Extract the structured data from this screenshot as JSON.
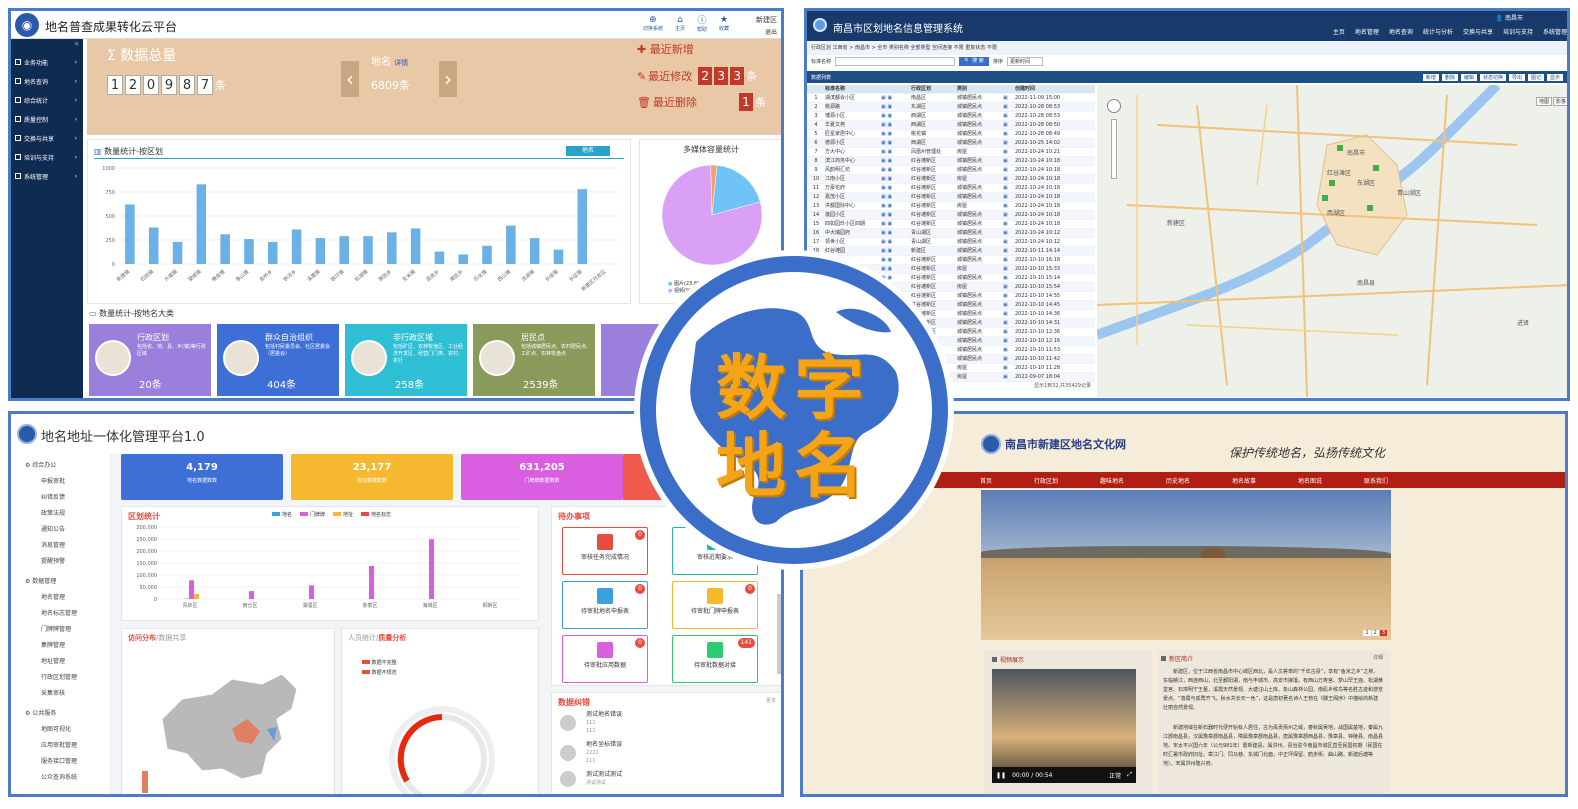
{
  "p1": {
    "title": "地名普查成果转化云平台",
    "header_icons": [
      "切换系统",
      "主页",
      "帮助",
      "收藏"
    ],
    "header_user": "新建区",
    "header_logout": "退出",
    "sidebar": [
      "业务功能",
      "地名查询",
      "综合统计",
      "质量控制",
      "交换与共享",
      "培训与支持",
      "系统管理"
    ],
    "total_label": "数据总量",
    "total_digits": [
      "1",
      "2",
      "0",
      "9",
      "8",
      "7"
    ],
    "total_unit": "条",
    "diming_label": "地名",
    "diming_link": "详情",
    "diming_count": "6809条",
    "recent_new": "最近新增",
    "recent_modified": "最近修改",
    "recent_modified_digits": [
      "2",
      "3",
      "3"
    ],
    "recent_deleted": "最近删除",
    "recent_deleted_digits": [
      "1"
    ],
    "recent_unit": "条",
    "bar_title": "数量统计-按区划",
    "bar_tab": "地名",
    "pie_title": "多媒体容量统计",
    "pie_legend": [
      "图片(23.86G)",
      "视频(97.99G)"
    ],
    "cat_title": "数量统计-按地名大类",
    "cats": [
      {
        "name": "行政区划",
        "desc": "包括省、地、县、乡(镇)等行政区域",
        "count": "20条"
      },
      {
        "name": "群众自治组织",
        "desc": "包括村民委员会、社区居委会（居委会）",
        "count": "404条"
      },
      {
        "name": "非行政区域",
        "desc": "包括矿区、农林牧渔区、工业经济开发区、经营门门类、农村、农行",
        "count": "258条"
      },
      {
        "name": "居民点",
        "desc": "包括城镇居民点、农村居民点、工矿点、农林牧渔点",
        "count": "2539条"
      }
    ]
  },
  "chart1": {
    "type": "bar",
    "ylim": [
      0,
      1000
    ],
    "yticks": [
      "1000",
      "750",
      "500",
      "250",
      "0"
    ],
    "categories": [
      "新建镇",
      "石岗镇",
      "大塘镇",
      "望城镇",
      "樵舍镇",
      "象山镇",
      "金桥乡",
      "铁河乡",
      "溪霞镇",
      "联圩镇",
      "松湖镇",
      "厚田乡",
      "生米镇",
      "昌邑乡",
      "南矶乡",
      "乐化镇",
      "西山镇",
      "流湖镇",
      "长堎镇",
      "长征镇",
      "新建区开发区"
    ],
    "values": [
      620,
      380,
      230,
      830,
      310,
      260,
      230,
      360,
      270,
      290,
      290,
      330,
      370,
      130,
      100,
      190,
      400,
      270,
      150,
      780,
      0
    ]
  },
  "chart2": {
    "type": "pie",
    "slices": [
      {
        "name": "图片",
        "value": 23.86,
        "color": "#6fc3f7"
      },
      {
        "name": "视频",
        "value": 97.99,
        "color": "#d9a0f5"
      },
      {
        "name": "其他",
        "value": 2.5,
        "color": "#f3a06a"
      }
    ]
  },
  "p2": {
    "title": "南昌市区划地名信息管理系统",
    "menu": [
      "主页",
      "地名管理",
      "地名查询",
      "统计与分析",
      "交换与共享",
      "培训与支持",
      "系统管理"
    ],
    "user": "南昌市",
    "filters": "行政区划 江西省 > 南昌市 > 全市   类别名称 全部类型   空间连接 不限   重复状态 不限",
    "search_label": "标准名称",
    "search_button": "搜 索",
    "sort_label": "排序",
    "sort_value": "更新时间",
    "list_title": "数据列表",
    "toolbar": [
      "新增",
      "删除",
      "编辑",
      "状态切换",
      "导出",
      "图记",
      "显示"
    ],
    "columns": [
      "标准名称",
      "行政区划",
      "类别",
      "创建时间"
    ],
    "rows": [
      [
        "湖滨都会小区",
        "南昌区",
        "城镇居民点",
        "2022-11-09 15:00"
      ],
      [
        "桃源路",
        "东湖区",
        "城镇居民点",
        "2022-10-28 08:53"
      ],
      [
        "博源小区",
        "西湖区",
        "城镇居民点",
        "2022-10-28 08:53"
      ],
      [
        "华夏文苑",
        "西湖区",
        "城镇居民点",
        "2022-10-28 08:50"
      ],
      [
        "匠星家居中心",
        "桃花镇",
        "城镇居民点",
        "2022-10-28 08:49"
      ],
      [
        "德源小区",
        "西湖区",
        "城镇居民点",
        "2022-10-25 14:02"
      ],
      [
        "方大中心",
        "凤凰州管理处",
        "房屋",
        "2022-10-24 10:21"
      ],
      [
        "滨江商务中心",
        "红谷滩新区",
        "城镇居民点",
        "2022-10-24 10:18"
      ],
      [
        "风韵明汇坊",
        "红谷滩新区",
        "城镇居民点",
        "2022-10-24 10:18"
      ],
      [
        "江南小区",
        "红谷滩新区",
        "房屋",
        "2022-10-24 10:18"
      ],
      [
        "万豪花府",
        "红谷滩新区",
        "城镇居民点",
        "2022-10-24 10:18"
      ],
      [
        "嘉茂小区",
        "红谷滩新区",
        "城镇居民点",
        "2022-10-24 10:18"
      ],
      [
        "洪都国际中心",
        "红谷滩新区",
        "房屋",
        "2022-10-24 10:18"
      ],
      [
        "莲园小区",
        "红谷滩新区",
        "城镇居民点",
        "2022-10-24 10:18"
      ],
      [
        "四如园珍小区四期",
        "红谷滩新区",
        "城镇居民点",
        "2022-10-24 10:18"
      ],
      [
        "中大瑞园府",
        "青山湖区",
        "城镇居民点",
        "2022-10-24 10:12"
      ],
      [
        "领世小区",
        "青山湖区",
        "城镇居民点",
        "2022-10-24 10:12"
      ],
      [
        "红谷滩园",
        "新建区",
        "城镇居民点",
        "2022-10-11 14:14"
      ],
      [
        "",
        "红谷滩新区",
        "城镇居民点",
        "2022-10-10 16:18"
      ],
      [
        "",
        "红谷滩新区",
        "房屋",
        "2022-10-10 15:33"
      ],
      [
        "",
        "红谷滩新区",
        "城镇居民点",
        "2022-10-10 15:14"
      ],
      [
        "",
        "红谷滩新区",
        "房屋",
        "2022-10-10 15:54"
      ],
      [
        "",
        "红谷滩新区",
        "城镇居民点",
        "2022-10-10 14:55"
      ],
      [
        "",
        "红谷滩新区",
        "城镇居民点",
        "2022-10-10 14:45"
      ],
      [
        "",
        "红谷滩新区",
        "城镇居民点",
        "2022-10-10 14:36"
      ],
      [
        "",
        "红谷滩新区",
        "城镇居民点",
        "2022-10-10 14:31"
      ],
      [
        "",
        "红谷滩新区",
        "城镇居民点",
        "2022-10-10 12:36"
      ],
      [
        "",
        "红谷滩新区",
        "城镇居民点",
        "2022-10-10 12:16"
      ],
      [
        "",
        "红谷滩新区",
        "城镇居民点",
        "2022-10-10 11:53"
      ],
      [
        "",
        "红谷滩新区",
        "城镇居民点",
        "2022-10-10 11:42"
      ],
      [
        "",
        "红谷滩新区",
        "房屋",
        "2022-10-10 11:28"
      ],
      [
        "",
        "红谷滩新区",
        "房屋",
        "2022-09-07 18:04"
      ]
    ],
    "footer": "显示1到32,共35429记录",
    "map_tabs": [
      "地图",
      "影像"
    ],
    "map_labels": [
      "南昌市",
      "新建区",
      "青山湖区",
      "东湖区",
      "西湖区",
      "红谷滩区",
      "南昌县",
      "进贤"
    ]
  },
  "p3": {
    "title": "地名地址一体化管理平台1.0",
    "nav": [
      {
        "group": "综合办公",
        "items": [
          "申报审批",
          "纠错反馈",
          "政策法规",
          "通知公告",
          "消息管理",
          "提醒预警"
        ]
      },
      {
        "group": "数据管理",
        "items": [
          "地名管理",
          "地名标志管理",
          "门牌牌管理",
          "集牌管理",
          "地址管理",
          "行政区划管理",
          "采集审核"
        ]
      },
      {
        "group": "公共服务",
        "items": [
          "地图可视化",
          "应用审批管理",
          "服务接口管理",
          "公众查询系统"
        ]
      }
    ],
    "stats": [
      {
        "value": "4,179",
        "label": "地名数据数数",
        "color": "#3d6fd6"
      },
      {
        "value": "23,177",
        "label": "地址数据数数",
        "color": "#f5b82e"
      },
      {
        "value": "631,205",
        "label": "门牌牌数据数数",
        "color": "#d95ee0"
      }
    ],
    "region_title": "区划统计",
    "legend": [
      "地名",
      "门牌牌",
      "地址",
      "地名标志"
    ],
    "region_yticks": [
      "300,000",
      "250,000",
      "200,000",
      "150,000",
      "100,000",
      "50,000",
      "0"
    ],
    "region_x": [
      "青妖区",
      "南仓区",
      "湖湄区",
      "象萦区",
      "海城区",
      "桐碗区"
    ],
    "todo_title": "待办事项",
    "todos": [
      {
        "label": "审核任务完成情况",
        "badge": "0",
        "color": "#e74c3c"
      },
      {
        "label": "审核近期要求",
        "badge": "",
        "color": "#2ab3a6"
      },
      {
        "label": "待审批地名申报表",
        "badge": "0",
        "color": "#3aa0e0"
      },
      {
        "label": "待审批门牌申报表",
        "badge": "0",
        "color": "#f5b82e"
      },
      {
        "label": "待审批应用数据",
        "badge": "0",
        "color": "#d95ee0"
      },
      {
        "label": "待审批数据对接",
        "badge": "141",
        "color": "#2ecc71"
      }
    ],
    "visit_title": "访问分布",
    "visit_subtitle": "数据共享",
    "quality_prefix": "人员统计/",
    "quality_title": "质量分析",
    "quality_legend": [
      "数据不完整",
      "数据不规范"
    ],
    "errata_title": "数据纠错",
    "errata_more": "更多",
    "errata": [
      {
        "name": "测试地名错误",
        "sub": "111",
        "sub2": "111"
      },
      {
        "name": "地名坐标错误",
        "sub": "2222",
        "sub2": "111"
      },
      {
        "name": "测试测试测试",
        "sub": "测试测试",
        "sub2": ""
      }
    ]
  },
  "p4": {
    "title": "南昌市新建区地名文化网",
    "slogan": "保护传统地名，弘扬传统文化",
    "nav": [
      "首页",
      "行政区划",
      "趣味地名",
      "历史地名",
      "地名故事",
      "地名图说",
      "联系我们"
    ],
    "slide_pages": [
      "1",
      "2",
      "3"
    ],
    "video_title": "视频展示",
    "video_time": "00:00 / 00:54",
    "video_speed": "正常",
    "intro_title": "新区简介",
    "intro_more": "详细",
    "intro_p1": "新建区，位于江西省南昌市中心城区西北，是人文荟萃的“千年古县”，享有“鱼米之乡”之称。东临赣江，西连西山，北至鄱阳湖，南与丰城市、高安市接壤。有西山万寿宫、梦山罕王庙、松湖黄堂宫、石埠明宁王墓，溪霞天然景观、大塘汪山土库、象山森林公园、南矶乡候鸟等名胜古迹和游览景点。“落霞与孤鹜齐飞，秋水共长天一色”，这是唐初著名诗人王勃在《滕王阁序》中描绘的新建壮丽自然景观。",
    "intro_p2": "新建地域在新石器时代便开始有人居住，古为禹贡扬州之域，春秋属吴地，战国属楚地，秦属九江郡南昌县，汉属豫章郡南昌县，隋属豫章郡南昌县，唐属豫章郡西昌县，豫章县、钟陵县、南昌县地。宋太平兴国六年（公元981年）置新建县，属洪州。县治驻今南昌市城区直至民国初期（民国在时汇署市政府旧址。章江门、同马巷、东城门北面，中正坪保留、鹤步街、曲山路、新建后塘等地）。宋属洪州隆兴府。"
  },
  "emblem": {
    "line1": "数字",
    "line2": "地名"
  }
}
